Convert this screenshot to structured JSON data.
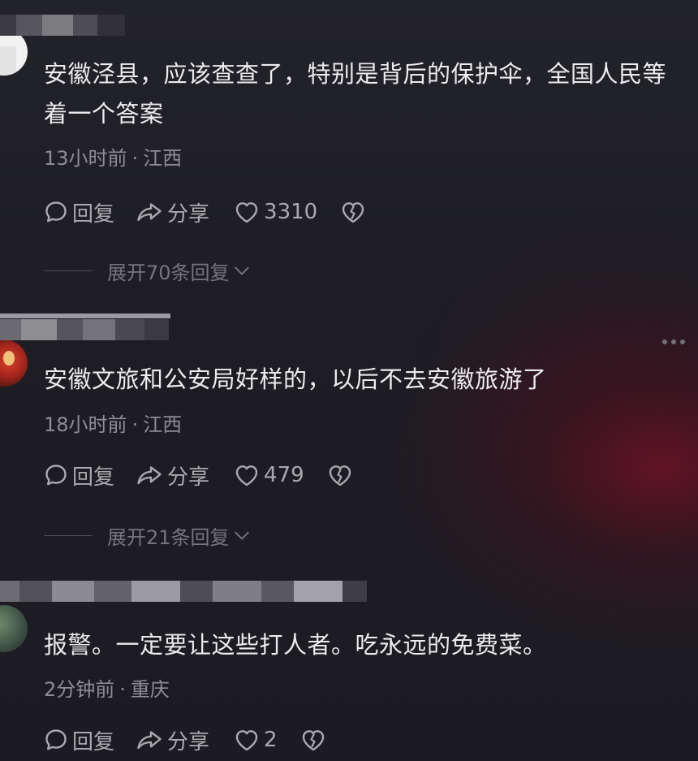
{
  "colors": {
    "background": "#1e1e24",
    "text_primary": "#ececee",
    "text_meta": "#8d8d94",
    "action_text": "#a9a9ae",
    "red_glow": "#6c1222"
  },
  "labels": {
    "reply": "回复",
    "share": "分享"
  },
  "comments": [
    {
      "text": "安徽泾县，应该查查了，特别是背后的保护伞，全国人民等着一个答案",
      "time": "13小时前",
      "location": "江西",
      "likes": "3310",
      "expand": "展开70条回复"
    },
    {
      "text": "安徽文旅和公安局好样的，以后不去安徽旅游了",
      "time": "18小时前",
      "location": "江西",
      "likes": "479",
      "expand": "展开21条回复"
    },
    {
      "text": "报警。一定要让这些打人者。吃永远的免费菜。",
      "time": "2分钟前",
      "location": "重庆",
      "likes": "2"
    }
  ],
  "icons": {
    "reply": "comment-bubble-icon",
    "share": "share-arrow-icon",
    "like": "heart-icon",
    "dislike": "broken-heart-icon",
    "expand": "chevron-down-icon",
    "more": "more-dots-icon"
  }
}
